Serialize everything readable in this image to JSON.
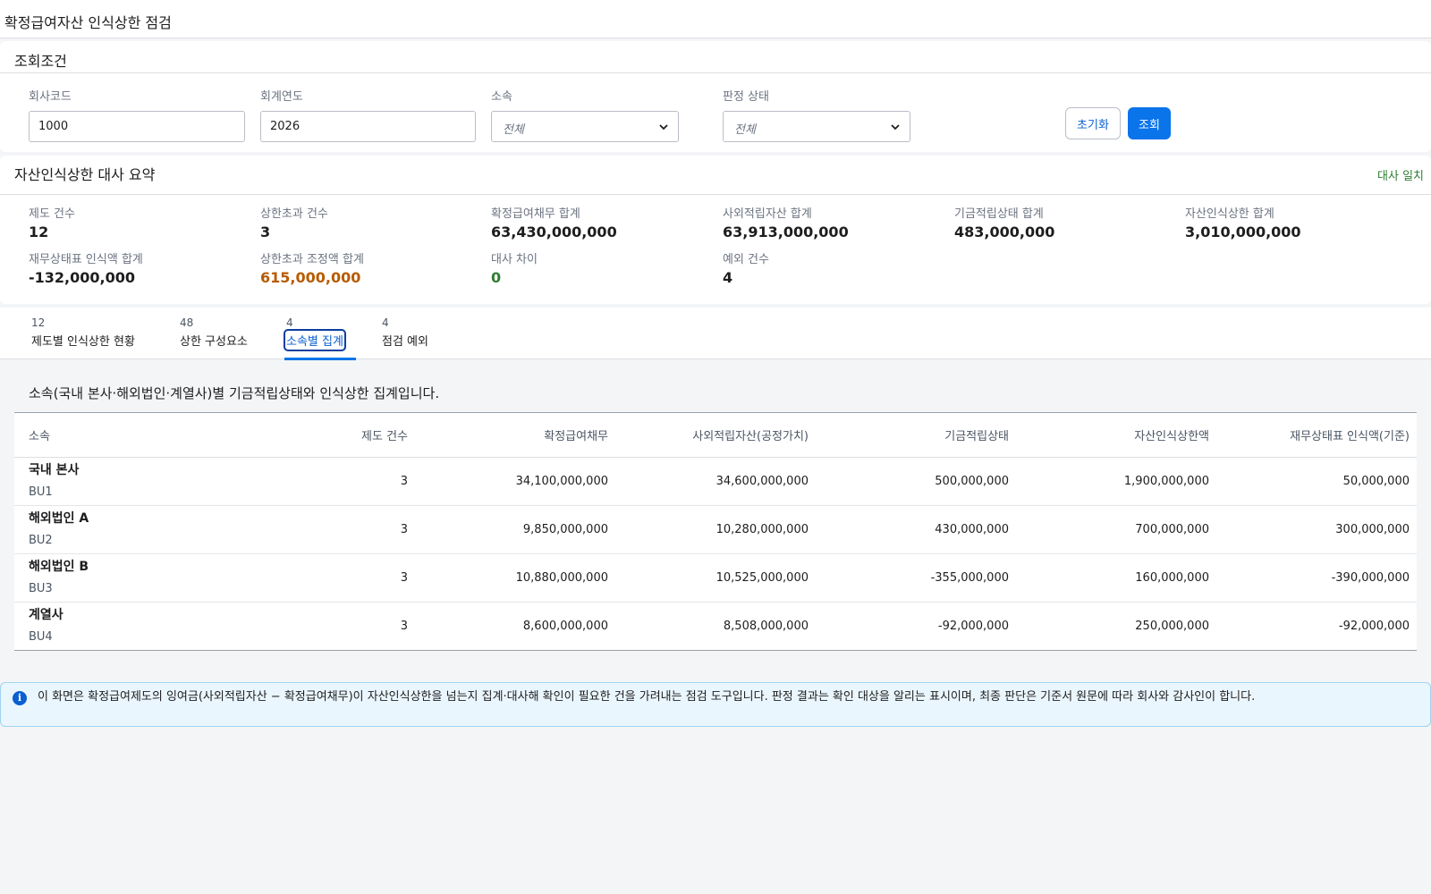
{
  "page": {
    "title": "확정급여자산 인식상한 점검"
  },
  "search": {
    "title": "조회조건",
    "company_code_label": "회사코드",
    "company_code_value": "1000",
    "fiscal_year_label": "회계연도",
    "fiscal_year_value": "2026",
    "affiliation_label": "소속",
    "affiliation_value": "전체",
    "judgment_label": "판정 상태",
    "judgment_value": "전체",
    "reset_label": "초기화",
    "search_label": "조회"
  },
  "summary": {
    "title": "자산인식상한 대사 요약",
    "match_status": "대사 일치",
    "metrics": [
      {
        "label": "제도 건수",
        "value": "12",
        "tone": "normal"
      },
      {
        "label": "상한초과 건수",
        "value": "3",
        "tone": "normal"
      },
      {
        "label": "확정급여채무 합계",
        "value": "63,430,000,000",
        "tone": "normal"
      },
      {
        "label": "사외적립자산 합계",
        "value": "63,913,000,000",
        "tone": "normal"
      },
      {
        "label": "기금적립상태 합계",
        "value": "483,000,000",
        "tone": "normal"
      },
      {
        "label": "자산인식상한 합계",
        "value": "3,010,000,000",
        "tone": "normal"
      },
      {
        "label": "재무상태표 인식액 합계",
        "value": "-132,000,000",
        "tone": "normal"
      },
      {
        "label": "상한초과 조정액 합계",
        "value": "615,000,000",
        "tone": "warn"
      },
      {
        "label": "대사 차이",
        "value": "0",
        "tone": "ok"
      },
      {
        "label": "예외 건수",
        "value": "4",
        "tone": "normal"
      }
    ]
  },
  "tabs": [
    {
      "count": "12",
      "label": "제도별 인식상한 현황",
      "active": false
    },
    {
      "count": "48",
      "label": "상한 구성요소",
      "active": false
    },
    {
      "count": "4",
      "label": "소속별 집계",
      "active": true
    },
    {
      "count": "4",
      "label": "점검 예외",
      "active": false
    }
  ],
  "section": {
    "description": "소속(국내 본사·해외법인·계열사)별 기금적립상태와 인식상한 집계입니다."
  },
  "table": {
    "headers": [
      "소속",
      "제도 건수",
      "확정급여채무",
      "사외적립자산(공정가치)",
      "기금적립상태",
      "자산인식상한액",
      "재무상태표 인식액(기준)"
    ],
    "rows": [
      {
        "name": "국내 본사",
        "code": "BU1",
        "plans": "3",
        "dbo": "34,100,000,000",
        "assets": "34,600,000,000",
        "funded": "500,000,000",
        "ceiling": "1,900,000,000",
        "recognized": "50,000,000"
      },
      {
        "name": "해외법인 A",
        "code": "BU2",
        "plans": "3",
        "dbo": "9,850,000,000",
        "assets": "10,280,000,000",
        "funded": "430,000,000",
        "ceiling": "700,000,000",
        "recognized": "300,000,000"
      },
      {
        "name": "해외법인 B",
        "code": "BU3",
        "plans": "3",
        "dbo": "10,880,000,000",
        "assets": "10,525,000,000",
        "funded": "-355,000,000",
        "ceiling": "160,000,000",
        "recognized": "-390,000,000"
      },
      {
        "name": "계열사",
        "code": "BU4",
        "plans": "3",
        "dbo": "8,600,000,000",
        "assets": "8,508,000,000",
        "funded": "-92,000,000",
        "ceiling": "250,000,000",
        "recognized": "-92,000,000"
      }
    ]
  },
  "info": {
    "icon": "info-icon",
    "text": "이 화면은 확정급여제도의 잉여금(사외적립자산 − 확정급여채무)이 자산인식상한을 넘는지 집계·대사해 확인이 필요한 건을 가려내는 점검 도구입니다. 판정 결과는 확인 대상을 알리는 표시이며, 최종 판단은 기준서 원문에 따라 회사와 감사인이 합니다."
  },
  "colors": {
    "primary": "#0a74ea",
    "warn": "#b75b00",
    "ok": "#2e7d32",
    "info_bg": "#eaf6fd"
  }
}
